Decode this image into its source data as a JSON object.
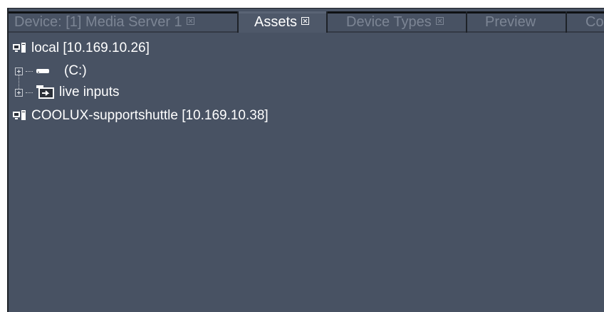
{
  "tabs": [
    {
      "label": "Device: [1] Media Server 1",
      "active": false,
      "closable": true
    },
    {
      "label": "Assets",
      "active": true,
      "closable": true
    },
    {
      "label": "Device Types",
      "active": false,
      "closable": true
    },
    {
      "label": "Preview",
      "active": false,
      "closable": false
    },
    {
      "label": "Co",
      "active": false,
      "closable": false
    }
  ],
  "tree": {
    "nodes": [
      {
        "label": "local [10.169.10.26]",
        "icon": "computer-icon"
      },
      {
        "label": "(C:)",
        "icon": "drive-icon"
      },
      {
        "label": "live inputs",
        "icon": "live-input-icon"
      },
      {
        "label": "COOLUX-supportshuttle [10.169.10.38]",
        "icon": "computer-icon"
      }
    ]
  },
  "colors": {
    "panel": "#485263",
    "text": "#ffffff",
    "inactive_tab_text": "#7c8594"
  }
}
